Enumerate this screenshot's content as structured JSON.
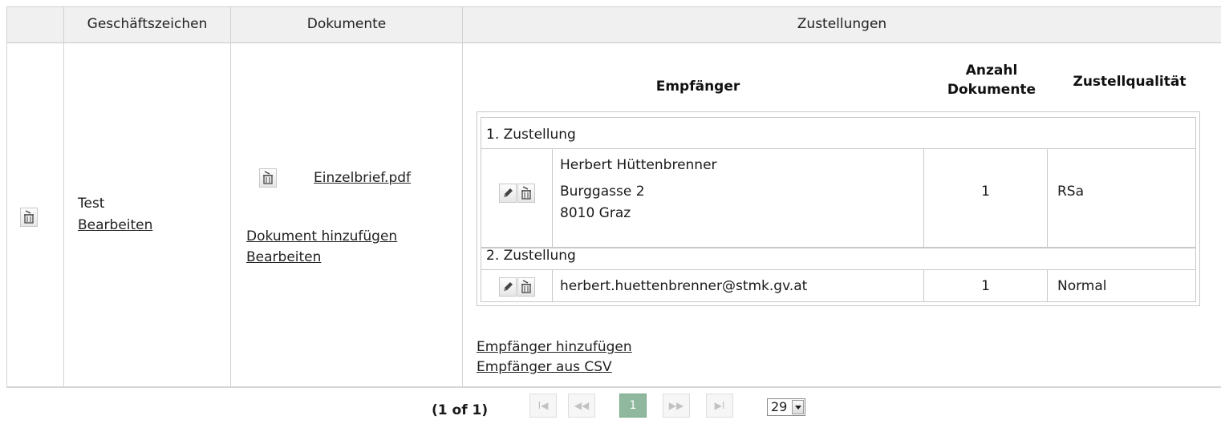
{
  "header": {
    "col_aktenzeichen": "Geschäftszeichen",
    "col_dokumente": "Dokumente",
    "col_zustellungen": "Zustellungen"
  },
  "row": {
    "geschaeftszeichen": "Test",
    "edit_link": "Bearbeiten",
    "document_name": "Einzelbrief.pdf",
    "add_document_link": "Dokument hinzufügen",
    "edit_documents_link": "Bearbeiten"
  },
  "deliveries": {
    "head_recipient": "Empfänger",
    "head_count_line1": "Anzahl",
    "head_count_line2": "Dokumente",
    "head_quality": "Zustellqualität",
    "items": [
      {
        "title": "1. Zustellung",
        "recipient_line1": "Herbert Hüttenbrenner",
        "recipient_line2": "Burggasse 2",
        "recipient_line3": "8010 Graz",
        "count": "1",
        "quality": "RSa"
      },
      {
        "title": "2. Zustellung",
        "recipient_line1": "herbert.huettenbrenner@stmk.gv.at",
        "count": "1",
        "quality": "Normal"
      }
    ],
    "add_recipient_link": "Empfänger hinzufügen",
    "recipient_csv_link": "Empfänger aus CSV"
  },
  "paginator": {
    "status": "(1 of 1)",
    "first": "I◀",
    "prev": "◀◀",
    "current_page": "1",
    "next": "▶▶",
    "last": "▶I",
    "rows_per_page": "29"
  }
}
